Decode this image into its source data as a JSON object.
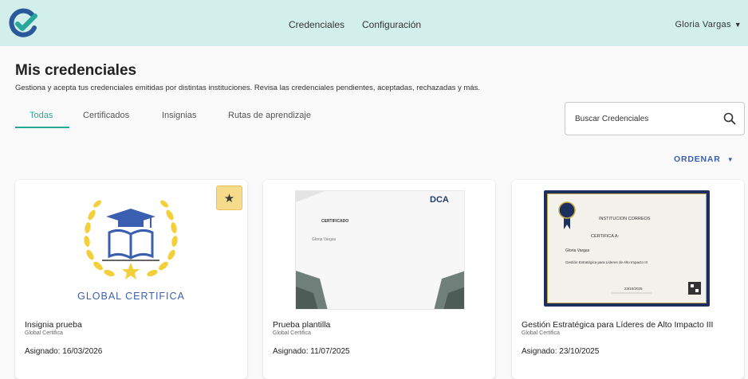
{
  "header": {
    "nav": [
      "Credenciales",
      "Configuración"
    ],
    "user_name": "Gloria Vargas"
  },
  "page": {
    "title": "Mis credenciales",
    "subtitle": "Gestiona y acepta tus credenciales emitidas por distintas instituciones. Revisa las credenciales pendientes, aceptadas, rechazadas y más."
  },
  "tabs": [
    "Todas",
    "Certificados",
    "Insignias",
    "Rutas de aprendizaje"
  ],
  "search": {
    "placeholder": "Buscar Credenciales"
  },
  "sort": {
    "label": "ORDENAR"
  },
  "colors": {
    "accent": "#2aa79b",
    "header_bg": "#d3efec",
    "link": "#3a5fb0",
    "star_bg": "#f6dc8a"
  },
  "cards": [
    {
      "title": "Insignia prueba",
      "org": "Global Certifica",
      "assigned": "Asignado: 16/03/2026",
      "badge_text": "GLOBAL CERTIFICA",
      "starred": true
    },
    {
      "title": "Prueba plantilla",
      "org": "Global Certifica",
      "assigned": "Asignado: 11/07/2025",
      "cert_heading": "CERTIFICADO",
      "cert_name": "Gloria Vargas",
      "cert_logo": "DCA"
    },
    {
      "title": "Gestión Estratégica para Líderes de Alto Impacto III",
      "org": "Global Certifica",
      "assigned": "Asignado: 23/10/2025",
      "cert_issuer": "INSTITUCION CORREOS",
      "cert_heading": "CERTIFICA A:",
      "cert_name": "Gloria Vargas",
      "cert_course": "Gestión Estratégica para Líderes de Alto Impacto III",
      "cert_date": "23/10/2025"
    }
  ]
}
